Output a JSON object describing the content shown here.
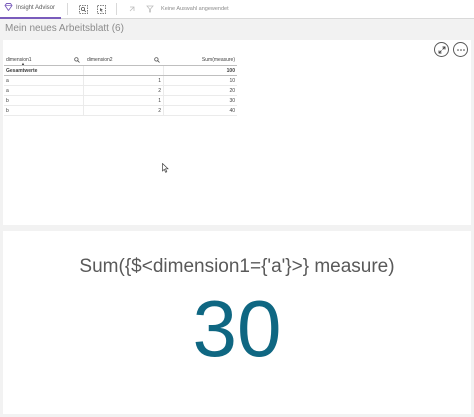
{
  "toolbar": {
    "insight_advisor_label": "Insight Advisor",
    "selection_status": "Keine Auswahl angewendet"
  },
  "sheet": {
    "title": "Mein neues Arbeitsblatt (6)"
  },
  "table": {
    "columns": [
      "dimension1",
      "dimension2",
      "Sum(measure)"
    ],
    "total": {
      "label": "Gesamtwerte",
      "value": "100"
    },
    "rows": [
      {
        "dimension1": "a",
        "dimension2": "1",
        "measure": "10"
      },
      {
        "dimension1": "a",
        "dimension2": "2",
        "measure": "20"
      },
      {
        "dimension1": "b",
        "dimension2": "1",
        "measure": "30"
      },
      {
        "dimension1": "b",
        "dimension2": "2",
        "measure": "40"
      }
    ]
  },
  "kpi": {
    "title": "Sum({$<dimension1={'a'}>} measure)",
    "value": "30",
    "value_color": "#0f6782"
  },
  "colors": {
    "accent": "#7a5cbc"
  }
}
